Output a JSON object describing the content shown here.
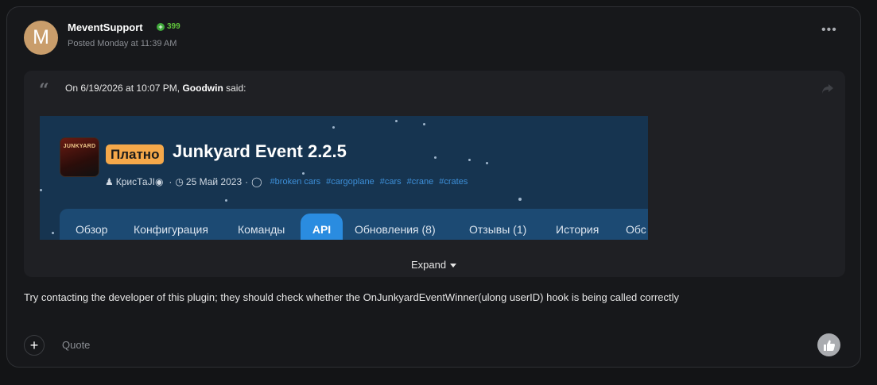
{
  "post": {
    "avatar_letter": "M",
    "author": "MeventSupport",
    "reputation": "399",
    "posted": "Posted Monday at 11:39 AM",
    "more_label": "•••",
    "body": "Try contacting the developer of this plugin; they should check whether the OnJunkyardEventWinner(ulong userID) hook is being called correctly"
  },
  "quote": {
    "prefix": "On 6/19/2026 at 10:07 PM,",
    "author": "Goodwin",
    "suffix": " said:",
    "expand_label": "Expand"
  },
  "banner": {
    "icon_text": "JUNKYARD",
    "badge": "Платно",
    "title": "Junkyard Event 2.2.5",
    "author": "КрисТаJI",
    "date": "25 Май 2023",
    "tags": [
      "#broken cars",
      "#cargoplane",
      "#cars",
      "#crane",
      "#crates"
    ],
    "tabs": [
      "Обзор",
      "Конфигурация",
      "Команды",
      "API",
      "Обновления (8)",
      "Отзывы (1)",
      "История",
      "Обс"
    ],
    "active_tab": "API"
  },
  "footer": {
    "add_label": "+",
    "quote_label": "Quote"
  },
  "colors": {
    "background": "#131416",
    "card": "#17181b",
    "quote_bg": "#1f2024",
    "banner_bg": "#163450",
    "badge": "#f5a84a",
    "tag": "#3d8fd8",
    "reputation": "#5fc43b",
    "active_tab": "#2a8ce0"
  }
}
